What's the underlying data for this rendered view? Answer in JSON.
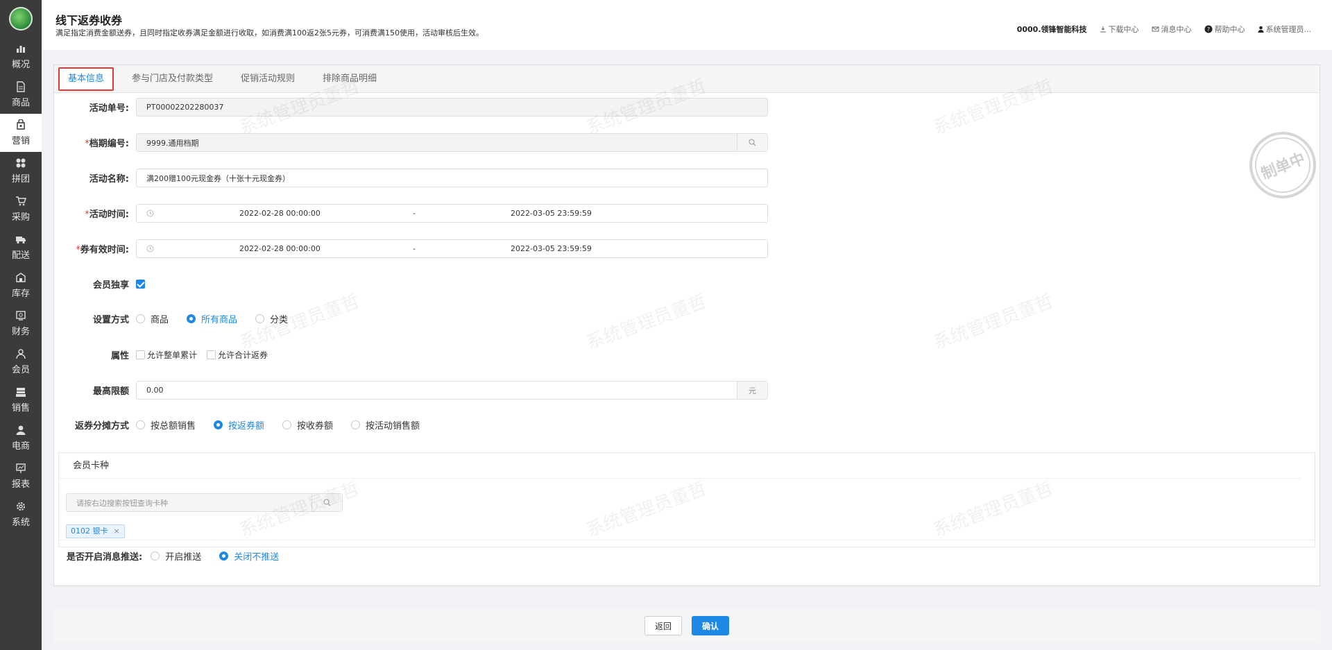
{
  "sidebar": {
    "items": [
      {
        "label": "概况",
        "icon": "overview-icon"
      },
      {
        "label": "商品",
        "icon": "goods-icon"
      },
      {
        "label": "营销",
        "icon": "marketing-icon"
      },
      {
        "label": "拼团",
        "icon": "group-buy-icon"
      },
      {
        "label": "采购",
        "icon": "cart-icon"
      },
      {
        "label": "配送",
        "icon": "truck-icon"
      },
      {
        "label": "库存",
        "icon": "warehouse-icon"
      },
      {
        "label": "财务",
        "icon": "finance-icon"
      },
      {
        "label": "会员",
        "icon": "member-icon"
      },
      {
        "label": "销售",
        "icon": "sales-icon"
      },
      {
        "label": "电商",
        "icon": "ecommerce-icon"
      },
      {
        "label": "报表",
        "icon": "report-icon"
      },
      {
        "label": "系统",
        "icon": "gear-icon"
      }
    ],
    "active_index": 2
  },
  "header": {
    "title": "线下返券收券",
    "desc": "满足指定消费金额送券，且同时指定收券满足金额进行收取，如消费满100返2张5元券，可消费满150使用，活动审核后生效。",
    "company": "0000.领锋智能科技",
    "download": "下载中心",
    "messages": "消息中心",
    "help": "帮助中心",
    "user": "系统管理员..."
  },
  "tabs": [
    "基本信息",
    "参与门店及付款类型",
    "促销活动规则",
    "排除商品明细"
  ],
  "form": {
    "order_no": {
      "label": "活动单号:",
      "value": "PT00002202280037"
    },
    "period_no": {
      "label": "档期编号:",
      "value": "9999.通用档期"
    },
    "name": {
      "label": "活动名称:",
      "value": "满200赠100元现金券（十张十元现金券）"
    },
    "time": {
      "label": "活动时间:",
      "start": "2022-02-28 00:00:00",
      "sep": "-",
      "end": "2022-03-05 23:59:59"
    },
    "coupon_time": {
      "label": "券有效时间:",
      "start": "2022-02-28 00:00:00",
      "sep": "-",
      "end": "2022-03-05 23:59:59"
    },
    "member_only": {
      "label": "会员独享",
      "checked": true
    },
    "setup": {
      "label": "设置方式",
      "options": [
        "商品",
        "所有商品",
        "分类"
      ],
      "selected": 1
    },
    "attr": {
      "label": "属性",
      "options": [
        "允许整单累计",
        "允许合计返券"
      ]
    },
    "max_limit": {
      "label": "最高限额",
      "value": "0.00",
      "unit": "元"
    },
    "split": {
      "label": "返券分摊方式",
      "options": [
        "按总额销售",
        "按返券额",
        "按收券额",
        "按活动销售额"
      ],
      "selected": 1
    }
  },
  "member_card": {
    "title": "会员卡种",
    "search_placeholder": "请按右边搜索按钮查询卡种",
    "tag": "0102 银卡"
  },
  "push": {
    "label": "是否开启消息推送:",
    "options": [
      "开启推送",
      "关闭不推送"
    ],
    "selected": 1
  },
  "stamp": "制单中",
  "watermark": "系统管理员董哲",
  "buttons": {
    "back": "返回",
    "confirm": "确认"
  },
  "colors": {
    "accent": "#1e88e5",
    "required": "#e53935",
    "sidebar_bg": "#3b3b3b"
  }
}
